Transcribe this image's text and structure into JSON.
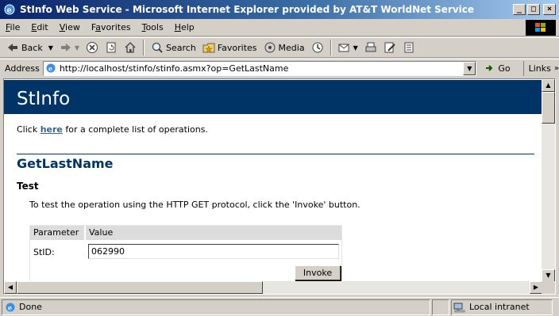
{
  "window": {
    "title": "StInfo Web Service - Microsoft Internet Explorer provided by AT&T WorldNet Service",
    "minimize": "_",
    "maximize": "□",
    "close": "×"
  },
  "menu": {
    "items": [
      {
        "label": "File",
        "underline": "F",
        "rest": "ile"
      },
      {
        "label": "Edit",
        "underline": "E",
        "rest": "dit"
      },
      {
        "label": "View",
        "underline": "V",
        "rest": "iew"
      },
      {
        "label": "Favorites",
        "underline": "a",
        "pre": "F",
        "rest": "vorites"
      },
      {
        "label": "Tools",
        "underline": "T",
        "rest": "ools"
      },
      {
        "label": "Help",
        "underline": "H",
        "rest": "elp"
      }
    ]
  },
  "toolbar": {
    "back_label": "Back",
    "search_label": "Search",
    "favorites_label": "Favorites",
    "media_label": "Media"
  },
  "address": {
    "label": "Address",
    "url": "http://localhost/stinfo/stinfo.asmx?op=GetLastName",
    "go_label": "Go",
    "links_label": "Links",
    "links_chevron": "»"
  },
  "page": {
    "heading": "StInfo",
    "intro_prefix": "Click ",
    "intro_link": "here",
    "intro_suffix": " for a complete list of operations.",
    "operation_name": "GetLastName",
    "test_heading": "Test",
    "test_text": "To test the operation using the HTTP GET protocol, click the 'Invoke' button.",
    "table": {
      "col_parameter": "Parameter",
      "col_value": "Value",
      "param_name": "StID:",
      "param_value": "062990",
      "invoke_label": "Invoke"
    }
  },
  "status": {
    "text": "Done",
    "zone": "Local intranet"
  }
}
